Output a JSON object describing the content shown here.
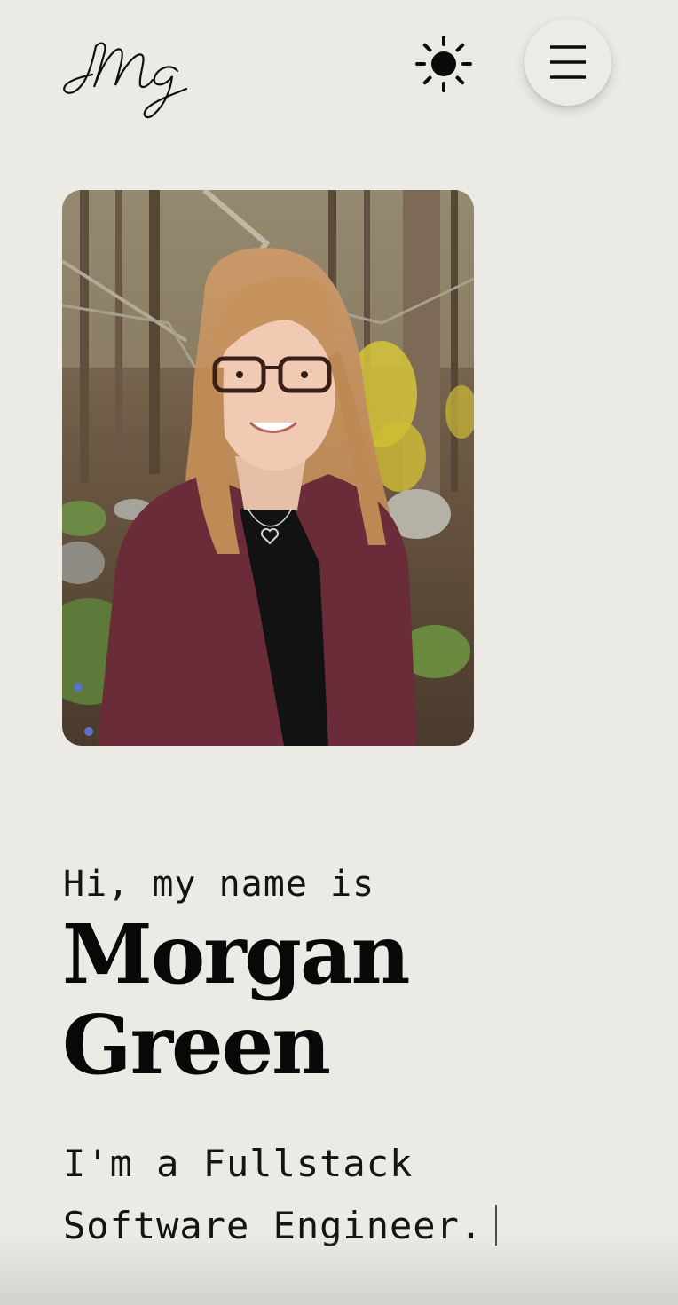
{
  "header": {
    "logo_text": "Mg",
    "theme_toggle_icon": "sun-icon",
    "menu_icon": "hamburger-menu-icon"
  },
  "hero": {
    "greeting": "Hi, my name is",
    "name_line1": "Morgan",
    "name_line2": "Green",
    "tagline_line1": "I'm a Fullstack",
    "tagline_line2": "Software Engineer."
  },
  "colors": {
    "background": "#ebeae5",
    "text": "#0c0c0c",
    "cardigan": "#6e2f3b",
    "hair": "#c59063"
  }
}
